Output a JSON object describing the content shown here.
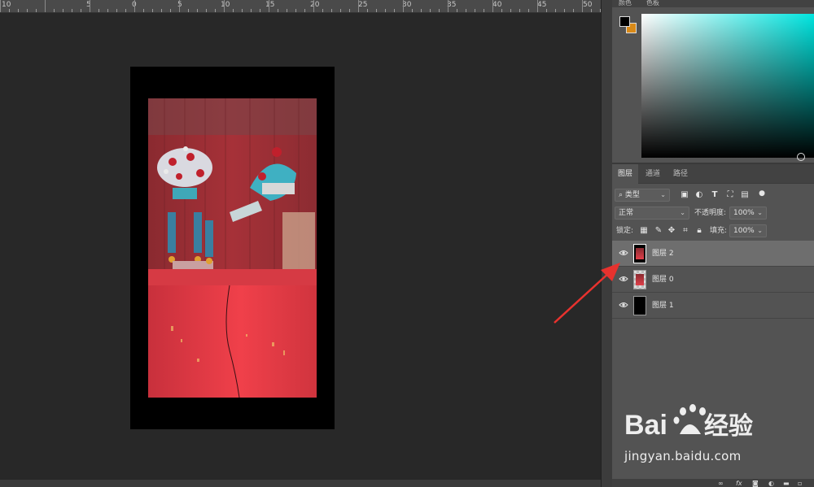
{
  "ruler": {
    "labels": [
      "10",
      "5",
      "0",
      "5",
      "10",
      "15",
      "20",
      "25",
      "30",
      "35",
      "40",
      "45",
      "50"
    ]
  },
  "color_panel": {
    "tabs": [
      "颜色",
      "色板"
    ],
    "foreground": "#000000",
    "background": "#d98a18",
    "hue": "#00e5e0"
  },
  "layers_panel": {
    "tabs": [
      "图层",
      "通道",
      "路径"
    ],
    "filter_kind": "类型",
    "blend_mode": "正常",
    "opacity_label": "不透明度:",
    "opacity_value": "100%",
    "lock_label": "锁定:",
    "fill_label": "填充:",
    "fill_value": "100%",
    "layers": [
      {
        "name": "图层 2",
        "selected": true
      },
      {
        "name": "图层 0",
        "selected": false
      },
      {
        "name": "图层 1",
        "selected": false
      }
    ],
    "footer_icons": [
      "link-icon",
      "fx-icon",
      "mask-icon",
      "adjustment-icon",
      "group-icon",
      "new-layer-icon"
    ]
  },
  "watermark": {
    "logo": "Bai du 经验",
    "url": "jingyan.baidu.com"
  },
  "colors": {
    "annotation_arrow": "#e8322e"
  }
}
